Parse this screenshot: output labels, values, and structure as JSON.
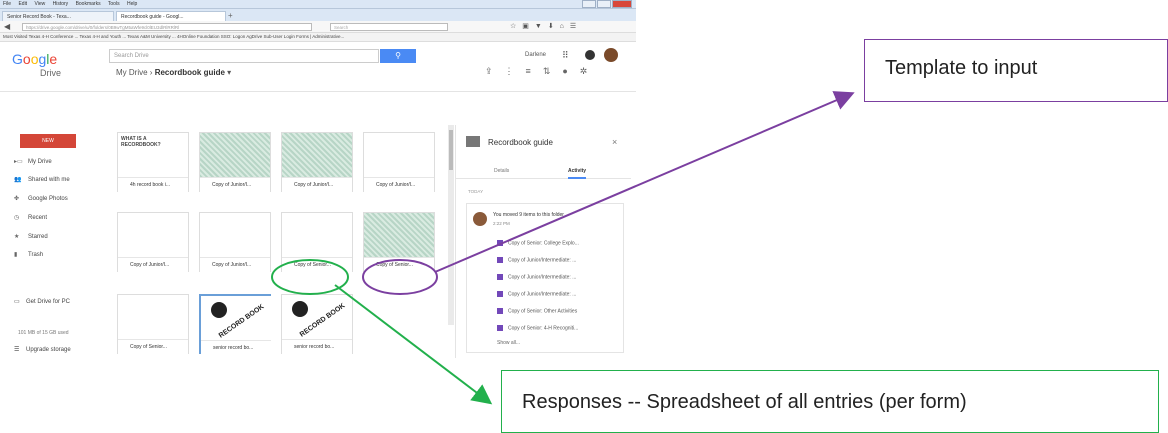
{
  "browser": {
    "menu": [
      "File",
      "Edit",
      "View",
      "History",
      "Bookmarks",
      "Tools",
      "Help"
    ],
    "tabs": [
      "Senior Record Book - Texa...",
      "Recordbook guide - Googl..."
    ],
    "new_tab": "+",
    "url": "https://drive.google.com/drive/u/0/folders/0B9wTgM5aWfe9cl0lEU3dlRlRRlRl",
    "search_placeholder": "Search",
    "bookmarks": "Most Visited   Texas 4-H Conference ...   Texas 4-H and Youth ...   Texas A&M University ...   4HOnline   Foundation   SSO: Logon   AgDrive   Sub-User Login   Forms | Administrative..."
  },
  "drive": {
    "logo": "Google",
    "search_placeholder": "Search Drive",
    "search_icon": "search-icon",
    "user": "Darlene",
    "app_label": "Drive",
    "breadcrumb_root": "My Drive",
    "breadcrumb_sep": "›",
    "breadcrumb_current": "Recordbook guide",
    "new_button": "NEW",
    "sidebar": [
      "My Drive",
      "Shared with me",
      "Google Photos",
      "Recent",
      "Starred",
      "Trash"
    ],
    "get_drive": "Get Drive for PC",
    "storage": "101 MB of 15 GB used",
    "upgrade": "Upgrade storage"
  },
  "files": {
    "row1": [
      "4h record book i...",
      "Copy of Junior/I...",
      "Copy of Junior/I...",
      "Copy of Junior/I..."
    ],
    "row2": [
      "Copy of Junior/I...",
      "Copy of Junior/I...",
      "Copy of Senior...",
      "Copy of Senior..."
    ],
    "row3": [
      "Copy of Senior...",
      "senior record bo...",
      "senior record bo..."
    ],
    "thumb_title": "WHAT IS A RECORDBOOK?",
    "stamp_text": "RECORD BOOK"
  },
  "panel": {
    "title": "Recordbook guide",
    "close": "×",
    "tab_details": "Details",
    "tab_activity": "Activity",
    "today": "TODAY",
    "message": "You moved 9 items to this folder",
    "time": "2:22 PM",
    "items": [
      "Copy of Senior: College Explo...",
      "Copy of Junior/Intermediate: ...",
      "Copy of Junior/Intermediate: ...",
      "Copy of Junior/Intermediate: ...",
      "Copy of Senior: Other Activities",
      "Copy of Senior: 4-H Recogniti..."
    ],
    "show_all": "Show all..."
  },
  "annotations": {
    "template_label": "Template to input",
    "responses_label": "Responses -- Spreadsheet of all entries (per form)",
    "purple": "#7b3fa0",
    "green": "#22b04c"
  }
}
